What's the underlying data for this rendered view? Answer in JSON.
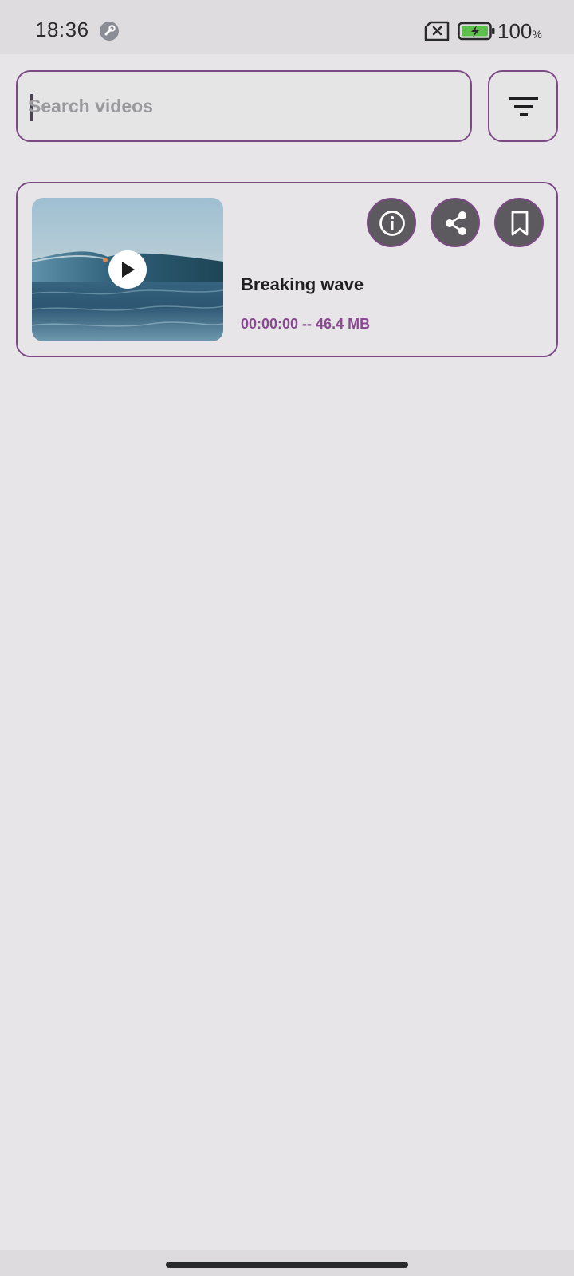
{
  "status_bar": {
    "time": "18:36",
    "battery_percent": "100",
    "battery_unit": "%",
    "icons": [
      "wrench-icon",
      "no-sim-icon",
      "battery-charging-icon"
    ]
  },
  "search": {
    "placeholder": "Search videos",
    "value": ""
  },
  "filter": {
    "icon": "filter-icon"
  },
  "videos": [
    {
      "title": "Breaking wave",
      "duration": "00:00:00",
      "separator": "--",
      "size": "46.4 MB",
      "meta": "00:00:00 -- 46.4 MB",
      "actions": [
        "info-icon",
        "share-icon",
        "bookmark-icon"
      ]
    }
  ],
  "colors": {
    "accent": "#7b4a85",
    "meta_text": "#8a4a92",
    "background": "#e7e5e8",
    "action_bg": "#5c5a5e"
  }
}
